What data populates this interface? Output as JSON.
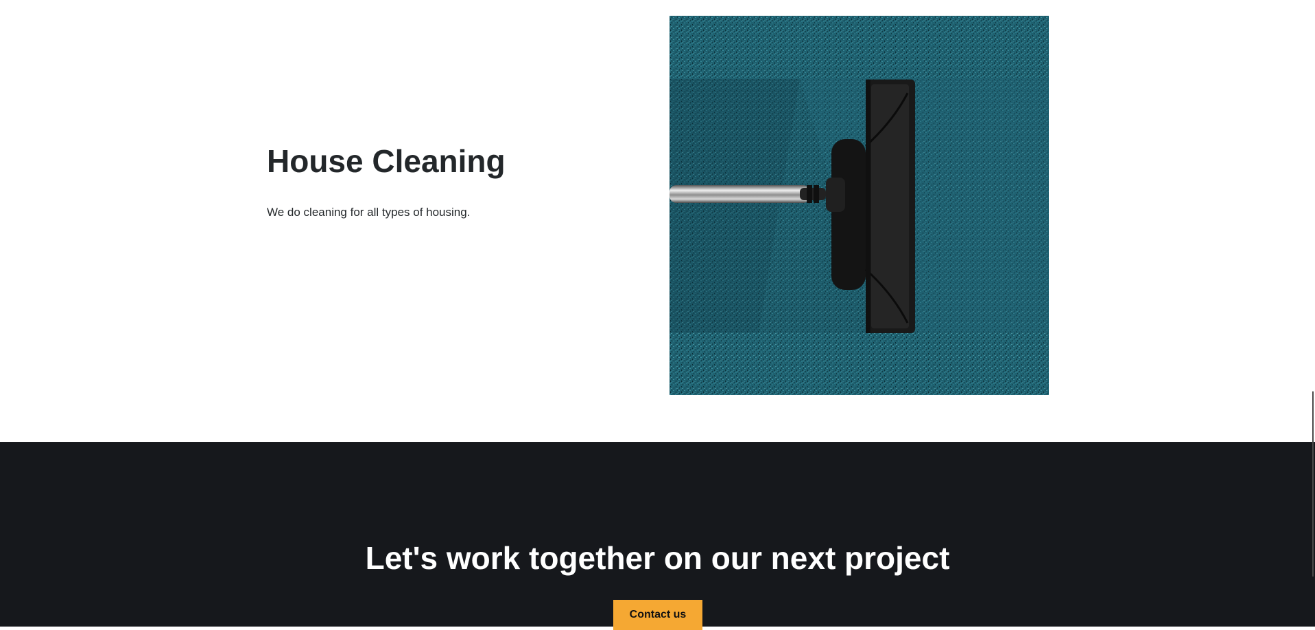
{
  "service": {
    "title": "House Cleaning",
    "description": "We do cleaning for all types of housing.",
    "image_subject": "vacuum cleaner head on teal carpet"
  },
  "cta": {
    "heading": "Let's work together on our next project",
    "button_label": "Contact us"
  },
  "colors": {
    "accent": "#f5a833",
    "dark_section": "#16181c",
    "text": "#23272a",
    "carpet": "#1d5b68"
  }
}
